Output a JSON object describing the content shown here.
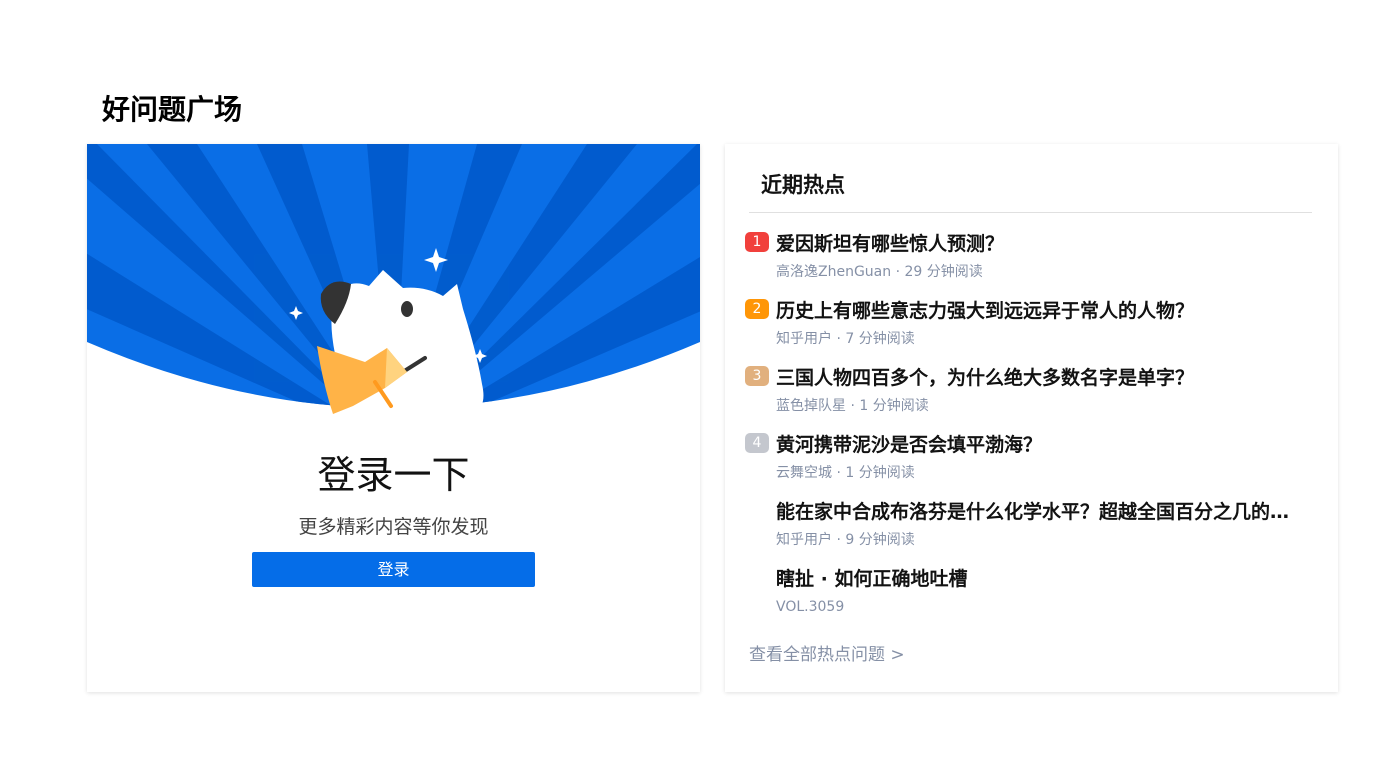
{
  "page": {
    "title": "好问题广场"
  },
  "login_card": {
    "heading": "登录一下",
    "subtitle": "更多精彩内容等你发现",
    "button_label": "登录"
  },
  "hot_card": {
    "title": "近期热点",
    "items": [
      {
        "rank": "1",
        "rank_color": "#f1403c",
        "title": "爱因斯坦有哪些惊人预测？",
        "meta": "高洛逸ZhenGuan · 29 分钟阅读"
      },
      {
        "rank": "2",
        "rank_color": "#ff9607",
        "title": "历史上有哪些意志力强大到远远异于常人的人物？",
        "meta": "知乎用户 · 7 分钟阅读"
      },
      {
        "rank": "3",
        "rank_color": "#e1b07e",
        "title": "三国人物四百多个，为什么绝大多数名字是单字？",
        "meta": "蓝色掉队星 · 1 分钟阅读"
      },
      {
        "rank": "4",
        "rank_color": "#c4c7ce",
        "title": "黄河携带泥沙是否会填平渤海？",
        "meta": "云舞空城 · 1 分钟阅读"
      },
      {
        "rank": "",
        "rank_color": "",
        "title": "能在家中合成布洛芬是什么化学水平？超越全国百分之几的人？",
        "meta": "知乎用户 · 9 分钟阅读"
      },
      {
        "rank": "",
        "rank_color": "",
        "title": "瞎扯 · 如何正确地吐槽",
        "meta": "VOL.3059"
      }
    ],
    "see_all_label": "查看全部热点问题 >"
  },
  "colors": {
    "brand_blue": "#056de8",
    "hero_blue_light": "#1a7ff0",
    "hero_blue_dark": "#0562d6",
    "mascot_orange": "#ffb347",
    "meta_gray": "#8590a6"
  },
  "icons": [
    "mascot-dog-icon",
    "sparkle-icon",
    "megaphone-icon"
  ]
}
